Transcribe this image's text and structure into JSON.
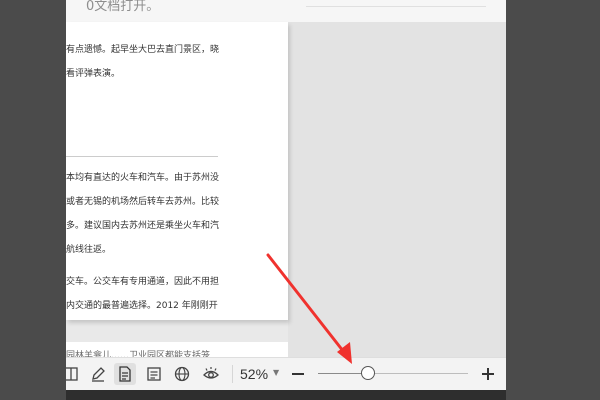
{
  "caption_top": "0文档打开。",
  "document": {
    "lines_top": [
      "有点遗憾。起早坐大巴去直门景区，晓",
      "看评弹表演。"
    ],
    "lines_main": [
      "本均有直达的火车和汽车。由于苏州没",
      "或者无锡的机场然后转车去苏州。比较",
      "多。建议国内去苏州还是乘坐火车和汽",
      "航线往返。",
      "交车。公交车有专用通道，因此不用担",
      "内交通的最普遍选择。2012 年刚刚开"
    ],
    "next_page_line": "园林羊龛儿……卫业园区都能支括笼"
  },
  "statusbar": {
    "icons": [
      "book-view-icon",
      "pen-icon",
      "page-view-icon",
      "outline-icon",
      "web-view-icon",
      "eye-protection-icon"
    ],
    "zoom_label": "52%",
    "zoom_fraction": 0.33
  },
  "colors": {
    "arrow": "#f0322e",
    "active_icon_bg": "#e0e0e0"
  }
}
